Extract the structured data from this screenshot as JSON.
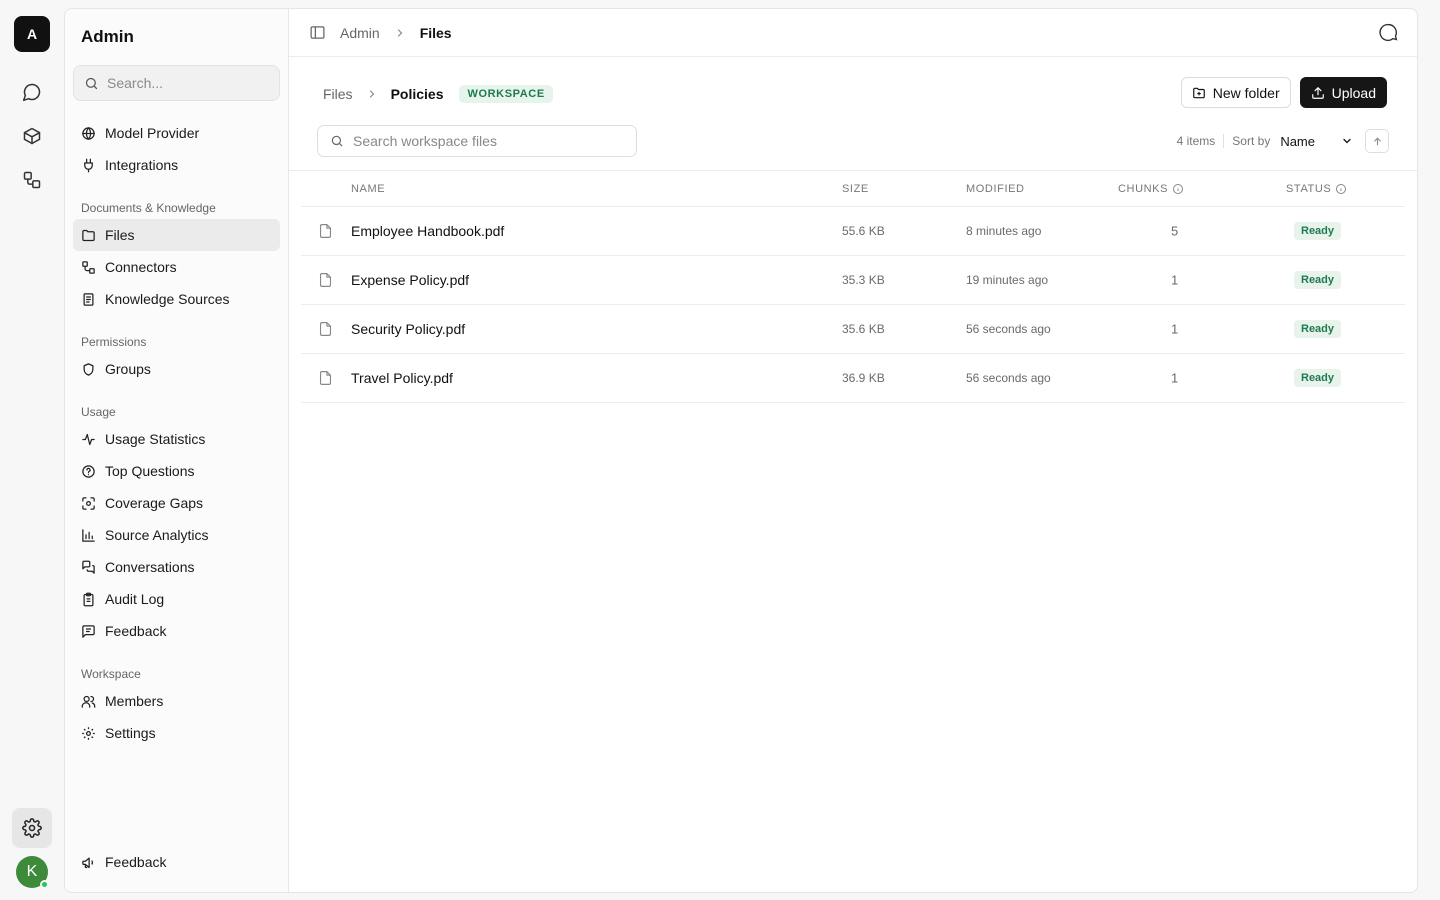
{
  "rail": {
    "logo": "A",
    "avatar": "K",
    "icons": [
      "chat-icon",
      "cube-icon",
      "workflow-icon"
    ]
  },
  "sidebar": {
    "title": "Admin",
    "search_placeholder": "Search...",
    "top_items": [
      {
        "label": "Model Provider",
        "icon": "globe-icon"
      },
      {
        "label": "Integrations",
        "icon": "plug-icon"
      }
    ],
    "groups": [
      {
        "label": "Documents & Knowledge",
        "items": [
          {
            "label": "Files",
            "icon": "folder-icon",
            "active": true
          },
          {
            "label": "Connectors",
            "icon": "connector-icon"
          },
          {
            "label": "Knowledge Sources",
            "icon": "book-icon"
          }
        ]
      },
      {
        "label": "Permissions",
        "items": [
          {
            "label": "Groups",
            "icon": "shield-icon"
          }
        ]
      },
      {
        "label": "Usage",
        "items": [
          {
            "label": "Usage Statistics",
            "icon": "activity-icon"
          },
          {
            "label": "Top Questions",
            "icon": "question-icon"
          },
          {
            "label": "Coverage Gaps",
            "icon": "scan-icon"
          },
          {
            "label": "Source Analytics",
            "icon": "bar-chart-icon"
          },
          {
            "label": "Conversations",
            "icon": "messages-icon"
          },
          {
            "label": "Audit Log",
            "icon": "clipboard-icon"
          },
          {
            "label": "Feedback",
            "icon": "message-square-icon"
          }
        ]
      },
      {
        "label": "Workspace",
        "items": [
          {
            "label": "Members",
            "icon": "users-icon"
          },
          {
            "label": "Settings",
            "icon": "gear-icon"
          }
        ]
      }
    ],
    "footer_feedback": "Feedback"
  },
  "topbar": {
    "breadcrumb_root": "Admin",
    "breadcrumb_current": "Files"
  },
  "files": {
    "breadcrumb_root": "Files",
    "breadcrumb_current": "Policies",
    "scope_badge": "WORKSPACE",
    "new_folder_label": "New folder",
    "upload_label": "Upload",
    "search_placeholder": "Search workspace files",
    "item_count": "4 items",
    "sort_label": "Sort by",
    "sort_value": "Name",
    "columns": {
      "name": "NAME",
      "size": "SIZE",
      "modified": "MODIFIED",
      "chunks": "CHUNKS",
      "status": "STATUS"
    },
    "rows": [
      {
        "name": "Employee Handbook.pdf",
        "size": "55.6 KB",
        "modified": "8 minutes ago",
        "chunks": "5",
        "status": "Ready"
      },
      {
        "name": "Expense Policy.pdf",
        "size": "35.3 KB",
        "modified": "19 minutes ago",
        "chunks": "1",
        "status": "Ready"
      },
      {
        "name": "Security Policy.pdf",
        "size": "35.6 KB",
        "modified": "56 seconds ago",
        "chunks": "1",
        "status": "Ready"
      },
      {
        "name": "Travel Policy.pdf",
        "size": "36.9 KB",
        "modified": "56 seconds ago",
        "chunks": "1",
        "status": "Ready"
      }
    ]
  }
}
